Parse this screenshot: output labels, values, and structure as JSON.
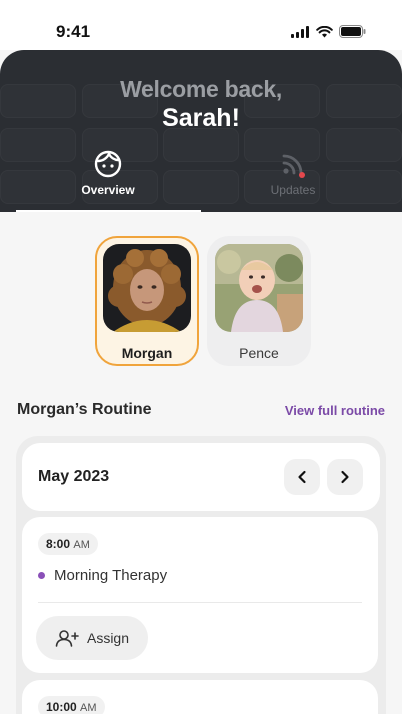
{
  "status_bar": {
    "time": "9:41"
  },
  "header": {
    "welcome": "Welcome back,",
    "username": "Sarah!",
    "tabs": [
      {
        "label": "Overview",
        "icon": "face-icon",
        "active": true
      },
      {
        "label": "Updates",
        "icon": "rss-icon",
        "active": false,
        "notification": true
      }
    ]
  },
  "children": [
    {
      "name": "Morgan",
      "selected": true
    },
    {
      "name": "Pence",
      "selected": false
    }
  ],
  "routine": {
    "title": "Morgan’s Routine",
    "view_link": "View full routine",
    "month": "May 2023",
    "events": [
      {
        "time": "8:00",
        "ampm": "AM",
        "name": "Morning Therapy",
        "assign_label": "Assign"
      },
      {
        "time": "10:00",
        "ampm": "AM"
      }
    ]
  },
  "colors": {
    "header_bg": "#2b2e33",
    "selected_border": "#f0a43c",
    "accent_purple": "#7b4aa7",
    "notification_dot": "#e5484d"
  }
}
